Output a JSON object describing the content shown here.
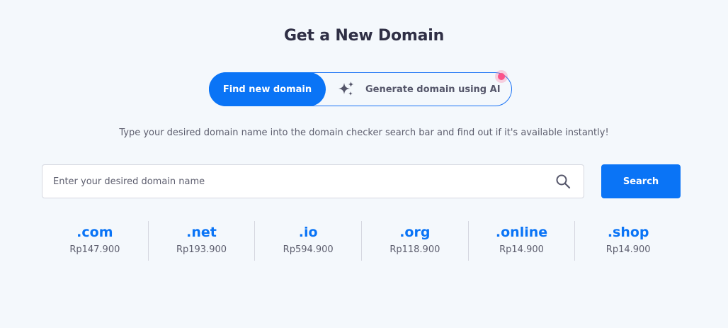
{
  "title": "Get a New Domain",
  "toggle": {
    "active_label": "Find new domain",
    "ai_label": "Generate domain using AI",
    "ai_icon": "sparkle-icon"
  },
  "subtitle": "Type your desired domain name into the domain checker search bar and find out if it's available instantly!",
  "search": {
    "placeholder": "Enter your desired domain name",
    "value": "",
    "icon": "search-icon",
    "button_label": "Search"
  },
  "colors": {
    "accent": "#0a74f6",
    "background": "#f4f8fc",
    "notification": "#fc5389"
  },
  "tlds": [
    {
      "name": ".com",
      "price": "Rp147.900"
    },
    {
      "name": ".net",
      "price": "Rp193.900"
    },
    {
      "name": ".io",
      "price": "Rp594.900"
    },
    {
      "name": ".org",
      "price": "Rp118.900"
    },
    {
      "name": ".online",
      "price": "Rp14.900"
    },
    {
      "name": ".shop",
      "price": "Rp14.900"
    }
  ]
}
